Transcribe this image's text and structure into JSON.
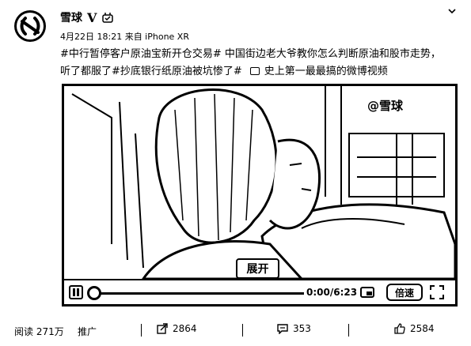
{
  "user": {
    "name": "雪球",
    "verified_mark": "V",
    "meta": "4月22日 18:21 来自 iPhone XR"
  },
  "post": {
    "text_main": "#中行暂停客户原油宝新开仓交易# 中国街边老大爷教你怎么判断原油和股市走势，听了都服了#抄底银行纸原油被坑惨了#",
    "video_link_label": "史上第一最最搞的微博视频"
  },
  "video": {
    "watermark": "@雪球",
    "expand_label": "展开",
    "time": "0:00/6:23",
    "speed_label": "倍速",
    "progress_fraction": 0
  },
  "footer": {
    "reads": "阅读 271万",
    "promo": "推广",
    "shares": "2864",
    "comments": "353",
    "likes": "2584"
  }
}
